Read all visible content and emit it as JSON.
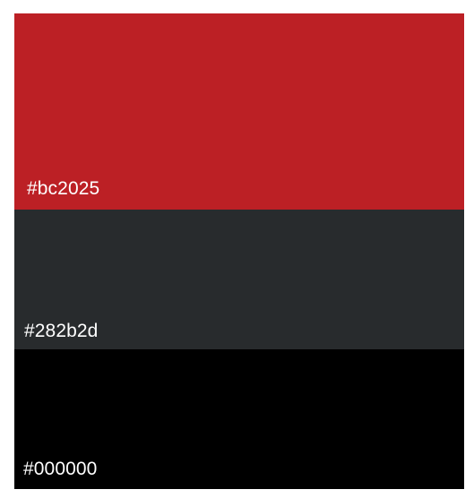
{
  "swatches": [
    {
      "label": "#bc2025",
      "color": "#bc2025"
    },
    {
      "label": "#282b2d",
      "color": "#282b2d"
    },
    {
      "label": "#000000",
      "color": "#000000"
    }
  ]
}
